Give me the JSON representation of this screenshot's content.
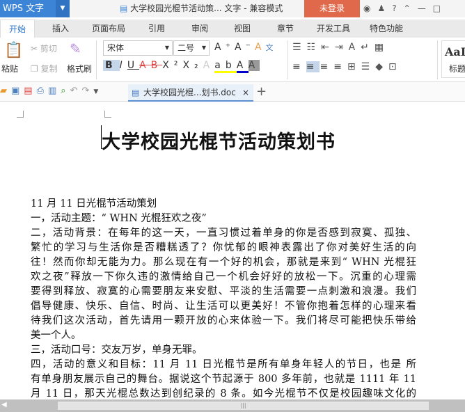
{
  "app": {
    "logo": "WPS 文字",
    "window_title": "大学校园光棍节活动策... 文字 - 兼容模式",
    "login": "未登录"
  },
  "tabs": [
    "开始",
    "插入",
    "页面布局",
    "引用",
    "审阅",
    "视图",
    "章节",
    "开发工具",
    "特色功能"
  ],
  "ribbon": {
    "paste": "粘贴",
    "cut": "剪切",
    "copy": "复制",
    "format_painter": "格式刷",
    "font": "宋体",
    "size": "二号",
    "style_preview": "AaI",
    "style_label": "标题"
  },
  "doc_tab": {
    "name": "大学校园光棍...划书.doc"
  },
  "document": {
    "title": "大学校园光棍节活动策划书",
    "lines": [
      "11 月 11 日光棍节活动策划",
      "一，活动主题：“ WHN 光棍狂欢之夜”",
      "二，活动背景：在每年的这一天，一直习惯过着单身的你是否感到寂寞、孤独、",
      "繁忙的学习与生活你是否糟糕透了？你忧郁的眼神表露出了你对美好生活的向",
      "往！然而你却无能为力。那么现在有一个好的机会，那就是来到“ WHN 光棍狂",
      "欢之夜”释放一下你久违的激情给自己一个机会好好的放松一下。沉重的心理需",
      "要得到释放、寂寞的心需要朋友来安慰、平淡的生活需要一点刺激和浪漫。我们",
      "倡导健康、快乐、自信、时尚、让生活可以更美好！不管你抱着怎样的心理来看",
      "待我们这次活动，首先请用一颗开放的心来体验一下。我们将尽可能把快乐带给",
      "美一个人。",
      "三，活动口号：交友万岁，单身无罪。",
      "四，活动的意义和目标：11 月 11 日光棍节是所有单身年轻人的节日，也是 所",
      "有单身朋友展示自己的舞台。据说这个节起源于 800 多年前，也就是 1111 年 11",
      "月 11 日，那天光棍总数达到创纪录的 8 条。如今光棍节不仅是校园趣味文化的"
    ]
  }
}
